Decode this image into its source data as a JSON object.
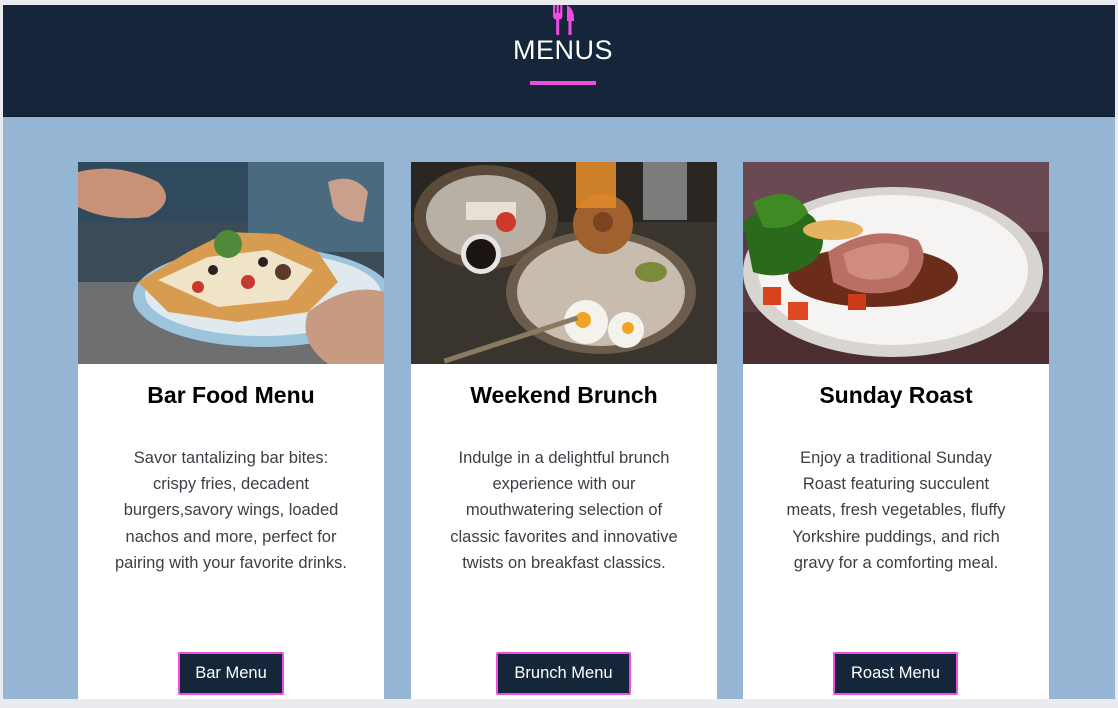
{
  "header": {
    "title": "MENUS",
    "icon": "cutlery-icon",
    "accent_color": "#ef4de0",
    "background_color": "#15263a"
  },
  "page": {
    "background_color": "#94b5d4"
  },
  "cards": [
    {
      "image": "nachos-photo",
      "title": "Bar Food Menu",
      "description": "Savor tantalizing bar bites: crispy fries, decadent burgers,savory wings, loaded nachos and more, perfect for pairing with your favorite drinks.",
      "button_label": "Bar Menu"
    },
    {
      "image": "brunch-photo",
      "title": "Weekend Brunch",
      "description": "Indulge in a delightful brunch experience with our mouthwatering selection of classic favorites and innovative twists on breakfast classics.",
      "button_label": "Brunch Menu"
    },
    {
      "image": "roast-photo",
      "title": "Sunday Roast",
      "description": "Enjoy a traditional Sunday Roast featuring succulent meats, fresh vegetables, fluffy Yorkshire puddings, and rich gravy for a comforting meal.",
      "button_label": "Roast Menu"
    }
  ]
}
